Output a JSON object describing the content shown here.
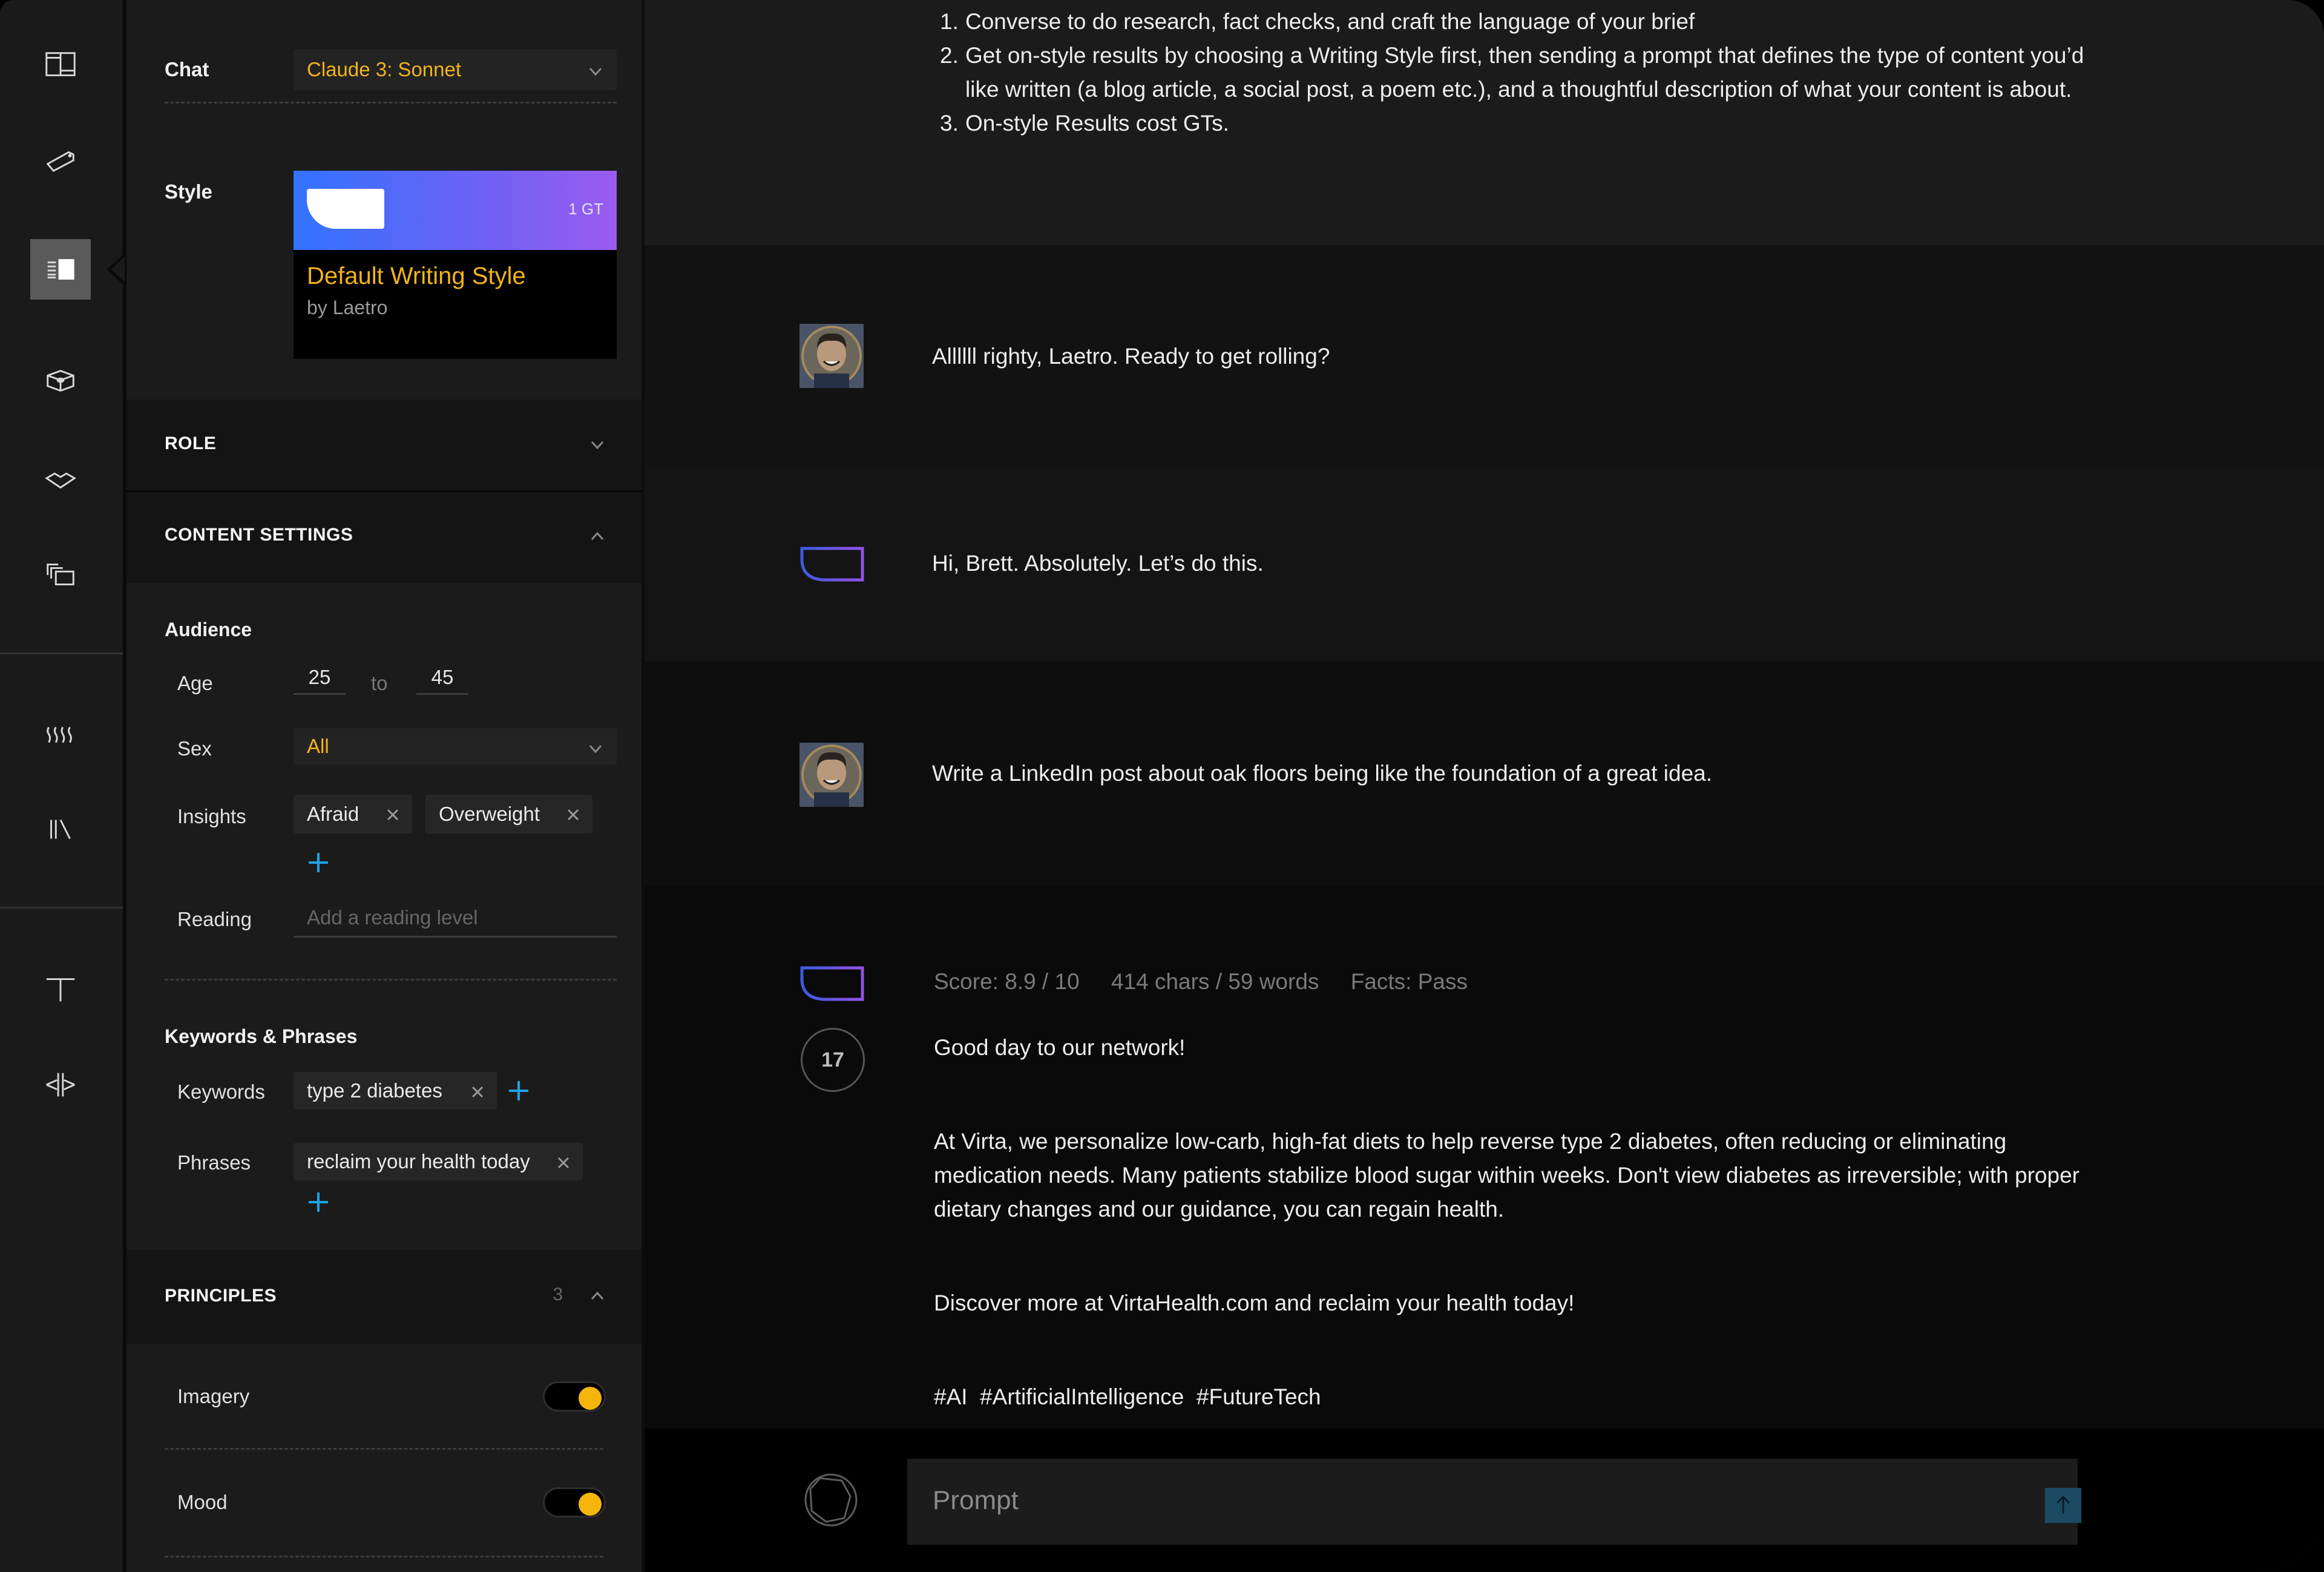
{
  "rail": {
    "items": [
      {
        "icon": "layout-grid-icon",
        "active": false
      },
      {
        "icon": "tag-icon",
        "active": false
      },
      {
        "icon": "writing-style-icon",
        "active": true
      },
      {
        "icon": "cube-icon",
        "active": false
      },
      {
        "icon": "diamond-icon",
        "active": false
      },
      {
        "icon": "stacked-frames-icon",
        "active": false
      },
      {
        "icon": "waves-icon",
        "active": false
      },
      {
        "icon": "library-icon",
        "active": false
      },
      {
        "icon": "text-icon",
        "active": false
      },
      {
        "icon": "asterisk-icon",
        "active": false
      }
    ]
  },
  "panel": {
    "chat": {
      "label": "Chat",
      "value": "Claude 3: Sonnet"
    },
    "style": {
      "label": "Style",
      "card_title": "Default Writing Style",
      "card_author": "by Laetro",
      "card_cost": "1 GT"
    },
    "role": {
      "label": "ROLE",
      "expanded": false
    },
    "content_settings": {
      "label": "CONTENT SETTINGS",
      "expanded": true,
      "audience": {
        "heading": "Audience",
        "age_label": "Age",
        "age_from": "25",
        "age_to_label": "to",
        "age_to": "45",
        "sex_label": "Sex",
        "sex_value": "All",
        "insights_label": "Insights",
        "insights": [
          "Afraid",
          "Overweight"
        ],
        "reading_label": "Reading",
        "reading_placeholder": "Add a reading level"
      },
      "keywords_phrases": {
        "heading": "Keywords & Phrases",
        "keywords_label": "Keywords",
        "keywords": [
          "type 2 diabetes"
        ],
        "phrases_label": "Phrases",
        "phrases": [
          "reclaim your health today"
        ]
      }
    },
    "principles": {
      "label": "PRINCIPLES",
      "count": "3",
      "expanded": true,
      "items": [
        {
          "label": "Imagery",
          "on": true
        },
        {
          "label": "Mood",
          "on": true
        }
      ]
    }
  },
  "colors": {
    "accent_yellow": "#f2b41a",
    "accent_blue": "#1fa3e6",
    "toggle_on": "#f5b50c",
    "send_button": "#1d4a63"
  },
  "chat": {
    "intro": [
      {
        "n": "1.",
        "text": "Converse to do research, fact checks, and craft the language of your brief"
      },
      {
        "n": "2.",
        "text": "Get on-style results by choosing a Writing Style first, then sending a prompt that defines the type of content you’d like written (a blog article, a social post, a poem etc.), and a thoughtful description of what your content is about."
      },
      {
        "n": "3.",
        "text": "On-style Results cost GTs."
      }
    ],
    "messages": [
      {
        "role": "user",
        "text": "Allllll righty, Laetro. Ready to get rolling?"
      },
      {
        "role": "assistant",
        "text": "Hi, Brett. Absolutely. Let’s do this."
      },
      {
        "role": "user",
        "text": "Write a LinkedIn post about oak floors being like the foundation of a great idea."
      }
    ],
    "result": {
      "score": "Score: 8.9 / 10",
      "length": "414 chars / 59 words",
      "facts": "Facts: Pass",
      "counter": "17",
      "paragraphs": [
        "Good day to our network!",
        "At Virta, we personalize low-carb, high-fat diets to help reverse type 2 diabetes, often reducing or eliminating medication needs. Many patients stabilize blood sugar within weeks. Don't view diabetes as irreversible; with proper dietary changes and our guidance, you can regain health.",
        "Discover more at VirtaHealth.com and reclaim your health today!",
        "#AI  #ArtificialIntelligence  #FutureTech"
      ]
    },
    "composer": {
      "placeholder": "Prompt"
    }
  }
}
